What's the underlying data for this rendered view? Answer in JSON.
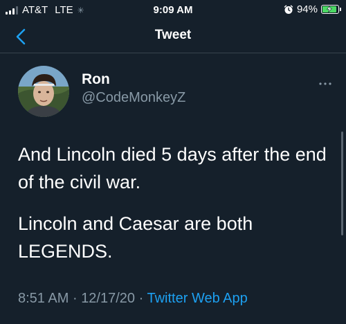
{
  "status_bar": {
    "carrier": "AT&T",
    "network": "LTE",
    "time": "9:09 AM",
    "battery_percent": "94%",
    "battery_level": 0.94,
    "signal_bars": 3,
    "signal_total": 4
  },
  "nav": {
    "title": "Tweet",
    "back_icon": "chevron-left-icon"
  },
  "tweet": {
    "user": {
      "name": "Ron",
      "handle": "@CodeMonkeyZ"
    },
    "paragraphs": [
      "And Lincoln died 5 days after the end of the civil war.",
      "Lincoln and Caesar are both LEGENDS."
    ],
    "time": "8:51 AM",
    "date": "12/17/20",
    "separator": "·",
    "source": "Twitter Web App"
  },
  "colors": {
    "background": "#15202b",
    "accent": "#1da1f2",
    "secondary_text": "#8899a6",
    "divider": "#38444d",
    "battery": "#4cd964"
  }
}
